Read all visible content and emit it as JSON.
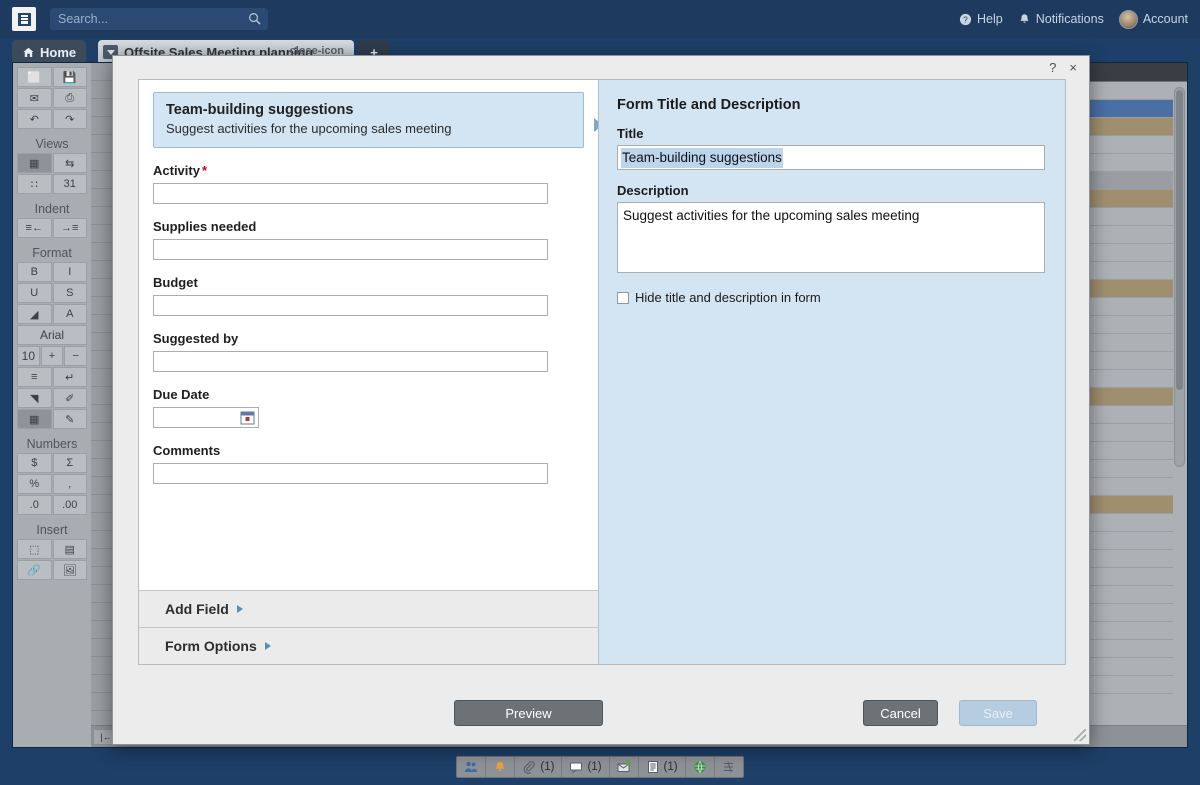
{
  "topbar": {
    "logo_icon": "app-logo-icon",
    "search": {
      "placeholder": "Search...",
      "value": "",
      "icon": "search-icon"
    },
    "help_label": "Help",
    "help_icon": "question-circle-icon",
    "notifications_label": "Notifications",
    "notifications_icon": "bell-icon",
    "account_label": "Account",
    "avatar_icon": "user-avatar"
  },
  "tabs": {
    "home_label": "Home",
    "home_icon": "home-icon",
    "document_label": "Offsite Sales Meeting planning",
    "document_caret_icon": "chevron-down-icon",
    "document_close_icon": "close-icon",
    "add_tab_label": "+"
  },
  "toolbar": {
    "groups": [
      {
        "title": "",
        "rows": [
          [
            {
              "icon": "new-document-icon",
              "glyph": "⬜",
              "label": ""
            },
            {
              "icon": "save-icon",
              "glyph": "💾",
              "label": ""
            }
          ],
          [
            {
              "icon": "email-icon",
              "glyph": "✉",
              "label": ""
            },
            {
              "icon": "print-icon",
              "glyph": "⎙",
              "label": ""
            }
          ],
          [
            {
              "icon": "undo-icon",
              "glyph": "↶",
              "label": ""
            },
            {
              "icon": "redo-icon",
              "glyph": "↷",
              "label": ""
            }
          ]
        ]
      },
      {
        "title": "Views",
        "rows": [
          [
            {
              "icon": "grid-view-icon",
              "glyph": "▦",
              "label": ""
            },
            {
              "icon": "gantt-view-icon",
              "glyph": "⇆",
              "label": ""
            }
          ],
          [
            {
              "icon": "card-view-icon",
              "glyph": "∷",
              "label": ""
            },
            {
              "icon": "calendar-view-icon",
              "glyph": "31",
              "label": ""
            }
          ]
        ]
      },
      {
        "title": "Indent",
        "rows": [
          [
            {
              "icon": "outdent-icon",
              "glyph": "≡←",
              "label": ""
            },
            {
              "icon": "indent-icon",
              "glyph": "→≡",
              "label": ""
            }
          ]
        ]
      },
      {
        "title": "Format",
        "rows": [
          [
            {
              "icon": "bold-icon",
              "glyph": "B",
              "label": ""
            },
            {
              "icon": "italic-icon",
              "glyph": "I",
              "label": ""
            }
          ],
          [
            {
              "icon": "underline-icon",
              "glyph": "U",
              "label": ""
            },
            {
              "icon": "strikethrough-icon",
              "glyph": "S",
              "label": ""
            }
          ],
          [
            {
              "icon": "fill-color-icon",
              "glyph": "◢",
              "label": ""
            },
            {
              "icon": "text-color-icon",
              "glyph": "A",
              "label": ""
            }
          ],
          [
            {
              "icon": "font-family-select",
              "glyph": "Arial",
              "label": "Arial"
            }
          ],
          [
            {
              "icon": "font-size-select",
              "glyph": "10",
              "label": "10"
            },
            {
              "icon": "font-size-increase-icon",
              "glyph": "+",
              "label": ""
            },
            {
              "icon": "font-size-decrease-icon",
              "glyph": "−",
              "label": ""
            }
          ],
          [
            {
              "icon": "align-icon",
              "glyph": "≡",
              "label": ""
            },
            {
              "icon": "wrap-text-icon",
              "glyph": "↵",
              "label": ""
            }
          ],
          [
            {
              "icon": "clear-format-icon",
              "glyph": "◥",
              "label": ""
            },
            {
              "icon": "format-painter-icon",
              "glyph": "✐",
              "label": ""
            }
          ],
          [
            {
              "icon": "conditional-format-icon",
              "glyph": "▦",
              "label": ""
            },
            {
              "icon": "highlight-icon",
              "glyph": "✎",
              "label": ""
            }
          ]
        ]
      },
      {
        "title": "Numbers",
        "rows": [
          [
            {
              "icon": "currency-icon",
              "glyph": "$",
              "label": ""
            },
            {
              "icon": "sum-icon",
              "glyph": "Σ",
              "label": ""
            }
          ],
          [
            {
              "icon": "percent-icon",
              "glyph": "%",
              "label": ""
            },
            {
              "icon": "thousands-separator-icon",
              "glyph": "‚",
              "label": ""
            }
          ],
          [
            {
              "icon": "decrease-decimal-icon",
              "glyph": ".0",
              "label": ""
            },
            {
              "icon": "increase-decimal-icon",
              "glyph": ".00",
              "label": ""
            }
          ]
        ]
      },
      {
        "title": "Insert",
        "rows": [
          [
            {
              "icon": "insert-row-icon",
              "glyph": "⬚",
              "label": ""
            },
            {
              "icon": "insert-column-icon",
              "glyph": "▤",
              "label": ""
            }
          ],
          [
            {
              "icon": "insert-link-icon",
              "glyph": "🔗",
              "label": ""
            },
            {
              "icon": "insert-image-icon",
              "glyph": "🖼",
              "label": ""
            }
          ]
        ]
      }
    ]
  },
  "dialog": {
    "help_label": "?",
    "close_label": "×",
    "form_header": {
      "title": "Team-building suggestions",
      "description": "Suggest activities for the upcoming sales meeting"
    },
    "fields": [
      {
        "label": "Activity",
        "required": true,
        "value": "",
        "type": "text"
      },
      {
        "label": "Supplies needed",
        "required": false,
        "value": "",
        "type": "text"
      },
      {
        "label": "Budget",
        "required": false,
        "value": "",
        "type": "text"
      },
      {
        "label": "Suggested by",
        "required": false,
        "value": "",
        "type": "text"
      },
      {
        "label": "Due Date",
        "required": false,
        "value": "",
        "type": "date"
      },
      {
        "label": "Comments",
        "required": false,
        "value": "",
        "type": "text"
      }
    ],
    "required_marker": "*",
    "accordions": [
      {
        "label": "Add Field",
        "caret_icon": "caret-right-icon"
      },
      {
        "label": "Form Options",
        "caret_icon": "caret-right-icon"
      }
    ],
    "panel": {
      "heading": "Form Title and Description",
      "title_label": "Title",
      "title_value": "Team-building suggestions",
      "description_label": "Description",
      "description_value": "Suggest activities for the upcoming sales meeting",
      "hide_checkbox_label": "Hide title and description in form",
      "hide_checkbox_checked": false
    },
    "buttons": {
      "preview": "Preview",
      "cancel": "Cancel",
      "save": "Save"
    }
  },
  "statusbar": {
    "cells": [
      {
        "icon": "contacts-icon",
        "count": ""
      },
      {
        "icon": "alerts-icon",
        "count": ""
      },
      {
        "icon": "attachment-icon",
        "count": "(1)"
      },
      {
        "icon": "discussion-icon",
        "count": "(1)"
      },
      {
        "icon": "update-request-icon",
        "count": ""
      },
      {
        "icon": "reports-icon",
        "count": "(1)"
      },
      {
        "icon": "publish-icon",
        "count": ""
      },
      {
        "icon": "activity-log-icon",
        "count": ""
      }
    ]
  },
  "colors": {
    "chrome_blue": "#1e3a5f",
    "panel_blue": "#d3e4f3",
    "selection_blue": "#bcd4ec",
    "accent_arrow": "#7fa9ca",
    "required_red": "#d0021b",
    "button_gray": "#6d7276",
    "save_disabled": "#b6cde1"
  }
}
